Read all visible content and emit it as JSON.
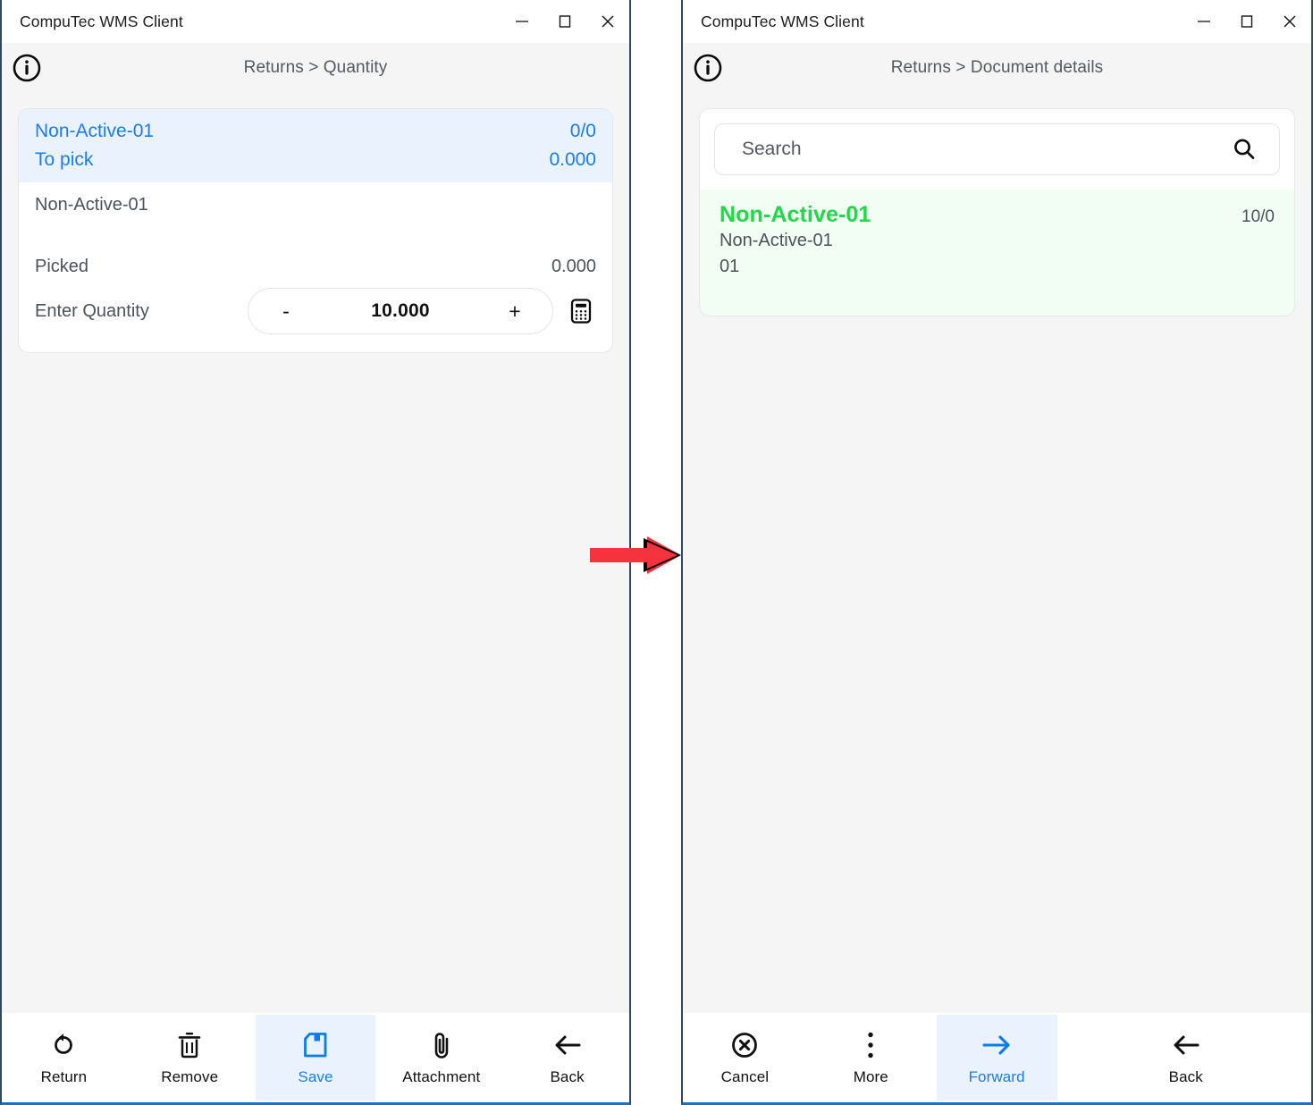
{
  "window_left": {
    "title": "CompuTec WMS Client",
    "controls": {
      "minimize": "minimize-icon",
      "maximize": "maximize-icon",
      "close": "close-icon"
    },
    "info_icon": "info-icon",
    "breadcrumb": "Returns > Quantity",
    "card": {
      "highlight": {
        "item_code": "Non-Active-01",
        "item_count": "0/0",
        "to_pick_label": "To pick",
        "to_pick_value": "0.000"
      },
      "item_name": "Non-Active-01",
      "picked_label": "Picked",
      "picked_value": "0.000",
      "quantity_label": "Enter Quantity",
      "stepper": {
        "minus": "-",
        "value": "10.000",
        "plus": "+"
      },
      "calculator_icon": "calculator-icon"
    },
    "toolbar": [
      {
        "label": "Return",
        "icon": "return-icon",
        "active": false
      },
      {
        "label": "Remove",
        "icon": "trash-icon",
        "active": false
      },
      {
        "label": "Save",
        "icon": "save-icon",
        "active": true
      },
      {
        "label": "Attachment",
        "icon": "paperclip-icon",
        "active": false
      },
      {
        "label": "Back",
        "icon": "arrow-left-icon",
        "active": false
      }
    ]
  },
  "window_right": {
    "title": "CompuTec WMS Client",
    "controls": {
      "minimize": "minimize-icon",
      "maximize": "maximize-icon",
      "close": "close-icon"
    },
    "info_icon": "info-icon",
    "breadcrumb": "Returns > Document details",
    "search": {
      "placeholder": "Search",
      "value": "",
      "icon": "search-icon"
    },
    "document": {
      "title": "Non-Active-01",
      "count": "10/0",
      "line1": "Non-Active-01",
      "line2": "01"
    },
    "toolbar": [
      {
        "label": "Cancel",
        "icon": "cancel-circle-icon",
        "active": false
      },
      {
        "label": "More",
        "icon": "dots-vertical-icon",
        "active": false
      },
      {
        "label": "Forward",
        "icon": "arrow-right-icon",
        "active": true
      },
      {
        "label": "Back",
        "icon": "arrow-left-icon",
        "active": false
      }
    ]
  },
  "annotation": {
    "arrow": "red-arrow-right",
    "arrow_color": "#f5333f",
    "arrow_outline": "#000000"
  },
  "colors": {
    "accent_blue": "#1a7cf0",
    "highlight_blue": "#eaf3fd",
    "accent_green": "#21d846",
    "highlight_green": "#f2fdf4",
    "window_border": "#2c4a63",
    "bottom_border": "#1573c7",
    "page_bg": "#f4f5f4"
  }
}
